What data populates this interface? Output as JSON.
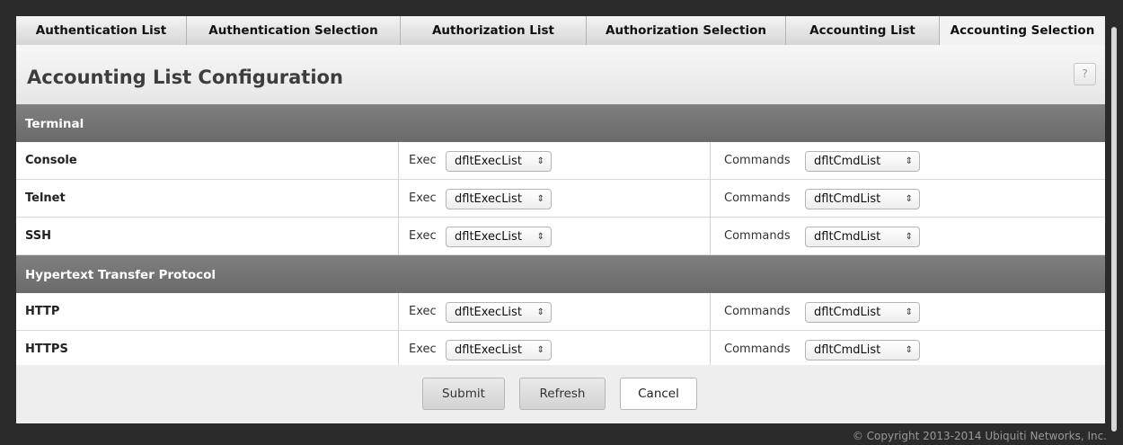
{
  "tabs": [
    {
      "label": "Authentication List",
      "active": false
    },
    {
      "label": "Authentication Selection",
      "active": false
    },
    {
      "label": "Authorization List",
      "active": false
    },
    {
      "label": "Authorization Selection",
      "active": false
    },
    {
      "label": "Accounting List",
      "active": false
    },
    {
      "label": "Accounting Selection",
      "active": true
    }
  ],
  "page": {
    "title": "Accounting List Configuration",
    "help_label": "?"
  },
  "groups": [
    {
      "label": "Terminal",
      "rows": [
        {
          "name": "Console",
          "exec_label": "Exec",
          "exec_value": "dfltExecList",
          "commands_label": "Commands",
          "commands_value": "dfltCmdList"
        },
        {
          "name": "Telnet",
          "exec_label": "Exec",
          "exec_value": "dfltExecList",
          "commands_label": "Commands",
          "commands_value": "dfltCmdList"
        },
        {
          "name": "SSH",
          "exec_label": "Exec",
          "exec_value": "dfltExecList",
          "commands_label": "Commands",
          "commands_value": "dfltCmdList"
        }
      ]
    },
    {
      "label": "Hypertext Transfer Protocol",
      "rows": [
        {
          "name": "HTTP",
          "exec_label": "Exec",
          "exec_value": "dfltExecList",
          "commands_label": "Commands",
          "commands_value": "dfltCmdList"
        },
        {
          "name": "HTTPS",
          "exec_label": "Exec",
          "exec_value": "dfltExecList",
          "commands_label": "Commands",
          "commands_value": "dfltCmdList"
        }
      ]
    }
  ],
  "buttons": {
    "submit": "Submit",
    "refresh": "Refresh",
    "cancel": "Cancel"
  },
  "footer": "© Copyright 2013-2014 Ubiquiti Networks, Inc.",
  "select_arrow": "⇕"
}
